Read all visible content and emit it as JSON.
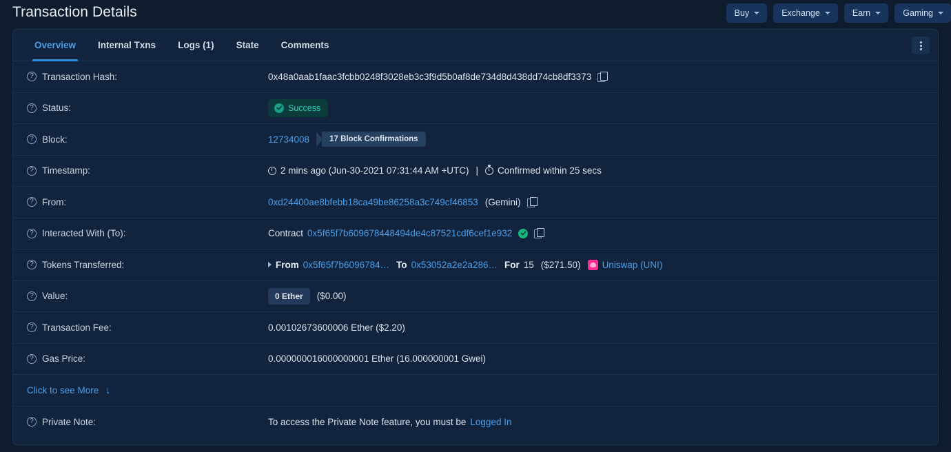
{
  "header": {
    "title": "Transaction Details",
    "nav_buttons": [
      {
        "label": "Buy",
        "icon": "chevron-down-icon"
      },
      {
        "label": "Exchange",
        "icon": "chevron-down-icon"
      },
      {
        "label": "Earn",
        "icon": "chevron-down-icon"
      },
      {
        "label": "Gaming",
        "icon": "chevron-down-icon"
      }
    ]
  },
  "tabs": [
    {
      "label": "Overview",
      "active": true
    },
    {
      "label": "Internal Txns",
      "active": false
    },
    {
      "label": "Logs (1)",
      "active": false
    },
    {
      "label": "State",
      "active": false
    },
    {
      "label": "Comments",
      "active": false
    }
  ],
  "menu": {
    "icon": "kebab-menu-icon"
  },
  "rows": {
    "tx_hash": {
      "label": "Transaction Hash:",
      "value": "0x48a0aab1faac3fcbb0248f3028eb3c3f9d5b0af8de734d8d438dd74cb8df3373"
    },
    "status": {
      "label": "Status:",
      "badge": "Success"
    },
    "block": {
      "label": "Block:",
      "number": "12734008",
      "confirmations": "17 Block Confirmations"
    },
    "timestamp": {
      "label": "Timestamp:",
      "ago": "2 mins ago (Jun-30-2021 07:31:44 AM +UTC)",
      "separator": "|",
      "confirmed": "Confirmed within 25 secs"
    },
    "from": {
      "label": "From:",
      "address": "0xd24400ae8bfebb18ca49be86258a3c749cf46853",
      "tag": "(Gemini)"
    },
    "to": {
      "label": "Interacted With (To):",
      "prefix": "Contract",
      "address": "0x5f65f7b609678448494de4c87521cdf6cef1e932"
    },
    "tokens": {
      "label": "Tokens Transferred:",
      "from_word": "From",
      "from_addr": "0x5f65f7b6096784…",
      "to_word": "To",
      "to_addr": "0x53052a2e2a286…",
      "for_word": "For",
      "amount": "15",
      "fiat": "($271.50)",
      "token": "Uniswap (UNI)"
    },
    "value": {
      "label": "Value:",
      "chip": "0 Ether",
      "fiat": "($0.00)"
    },
    "tx_fee": {
      "label": "Transaction Fee:",
      "value": "0.00102673600006 Ether ($2.20)"
    },
    "gas_price": {
      "label": "Gas Price:",
      "value": "0.000000016000000001 Ether (16.000000001 Gwei)"
    },
    "see_more": {
      "label": "Click to see More",
      "arrow": "↓"
    },
    "private_note": {
      "label": "Private Note:",
      "text": "To access the Private Note feature, you must be",
      "link": "Logged In"
    }
  },
  "colors": {
    "page_bg": "#0f1c2e",
    "card_bg": "#12233d",
    "link": "#4a9fe8",
    "success": "#2ecfb0",
    "uniswap": "#ff2d94"
  }
}
